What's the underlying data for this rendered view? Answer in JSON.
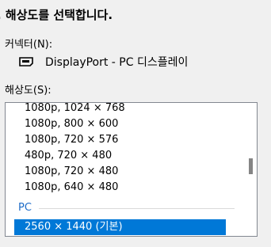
{
  "heading": ". 해상도를 선택합니다.",
  "connector": {
    "label": "커넥터(N):",
    "icon": "displayport-connector-icon",
    "name": "DisplayPort - PC 디스플레이"
  },
  "resolution": {
    "label": "해상도(S):",
    "items": [
      "1080p, 1024 × 768",
      "1080p, 800 × 600",
      "1080p, 720 × 576",
      "480p, 720 × 480",
      "1080p, 720 × 480",
      "1080p, 640 × 480"
    ],
    "group_label": "PC",
    "selected_item": "2560 × 1440 (기본)"
  },
  "colors": {
    "selection": "#0078d7",
    "group_header": "#1e6cc8"
  }
}
